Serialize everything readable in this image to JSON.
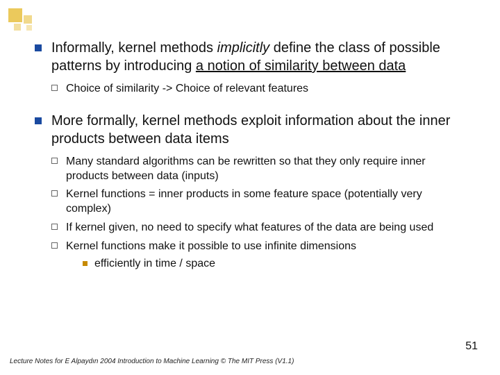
{
  "bullets": [
    {
      "pre": "Informally, kernel methods ",
      "italic": "implicitly",
      "post1": " define the class of possible patterns by introducing ",
      "under": "a notion of similarity between data",
      "sub": [
        {
          "text": "Choice of similarity -> Choice of relevant features"
        }
      ]
    },
    {
      "text": "More formally, kernel methods exploit information about the inner products between data items",
      "sub": [
        {
          "text": "Many standard algorithms can be rewritten so that they only require inner products between data (inputs)"
        },
        {
          "text": "Kernel functions = inner products in some feature space (potentially very complex)"
        },
        {
          "text": "If kernel given, no need to specify what features of the data are being used"
        },
        {
          "text": "Kernel functions make it possible to use infinite dimensions",
          "sub3": "efficiently in time / space"
        }
      ]
    }
  ],
  "footer": "Lecture Notes for E Alpaydın 2004 Introduction to Machine Learning © The MIT Press (V1.1)",
  "pagenum": "51"
}
